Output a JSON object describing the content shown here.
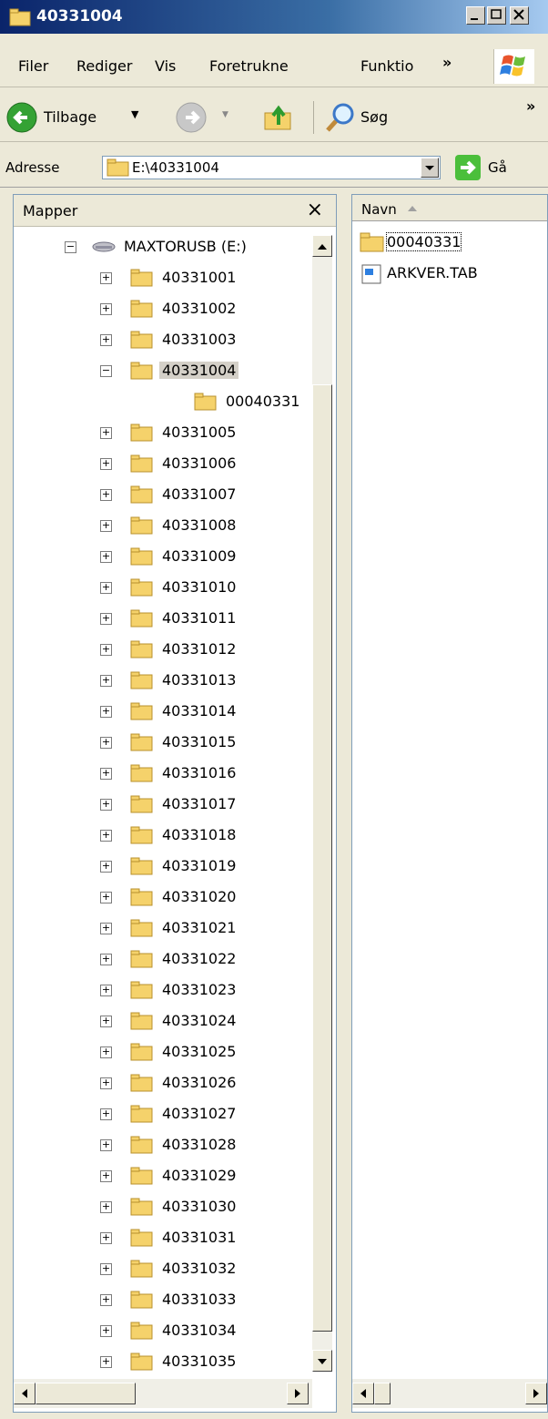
{
  "window": {
    "title": "40331004"
  },
  "menu": {
    "items": [
      "Filer",
      "Rediger",
      "Vis",
      "Foretrukne",
      "Funktio"
    ],
    "overflow": "»"
  },
  "toolbar": {
    "back_label": "Tilbage",
    "search_label": "Søg",
    "overflow": "»"
  },
  "address": {
    "label": "Adresse",
    "value": "E:\\40331004",
    "go_label": "Gå"
  },
  "folders_pane": {
    "title": "Mapper",
    "close": "×",
    "drive": "MAXTORUSB (E:)",
    "items": [
      {
        "label": "40331001",
        "expander": "+"
      },
      {
        "label": "40331002",
        "expander": "+"
      },
      {
        "label": "40331003",
        "expander": "+"
      },
      {
        "label": "40331004",
        "expander": "-",
        "selected": true
      },
      {
        "label": "00040331",
        "expander": "",
        "child": true
      },
      {
        "label": "40331005",
        "expander": "+"
      },
      {
        "label": "40331006",
        "expander": "+"
      },
      {
        "label": "40331007",
        "expander": "+"
      },
      {
        "label": "40331008",
        "expander": "+"
      },
      {
        "label": "40331009",
        "expander": "+"
      },
      {
        "label": "40331010",
        "expander": "+"
      },
      {
        "label": "40331011",
        "expander": "+"
      },
      {
        "label": "40331012",
        "expander": "+"
      },
      {
        "label": "40331013",
        "expander": "+"
      },
      {
        "label": "40331014",
        "expander": "+"
      },
      {
        "label": "40331015",
        "expander": "+"
      },
      {
        "label": "40331016",
        "expander": "+"
      },
      {
        "label": "40331017",
        "expander": "+"
      },
      {
        "label": "40331018",
        "expander": "+"
      },
      {
        "label": "40331019",
        "expander": "+"
      },
      {
        "label": "40331020",
        "expander": "+"
      },
      {
        "label": "40331021",
        "expander": "+"
      },
      {
        "label": "40331022",
        "expander": "+"
      },
      {
        "label": "40331023",
        "expander": "+"
      },
      {
        "label": "40331024",
        "expander": "+"
      },
      {
        "label": "40331025",
        "expander": "+"
      },
      {
        "label": "40331026",
        "expander": "+"
      },
      {
        "label": "40331027",
        "expander": "+"
      },
      {
        "label": "40331028",
        "expander": "+"
      },
      {
        "label": "40331029",
        "expander": "+"
      },
      {
        "label": "40331030",
        "expander": "+"
      },
      {
        "label": "40331031",
        "expander": "+"
      },
      {
        "label": "40331032",
        "expander": "+"
      },
      {
        "label": "40331033",
        "expander": "+"
      },
      {
        "label": "40331034",
        "expander": "+"
      },
      {
        "label": "40331035",
        "expander": "+"
      }
    ]
  },
  "file_list": {
    "column": "Navn",
    "items": [
      {
        "name": "00040331",
        "type": "folder"
      },
      {
        "name": "ARKVER.TAB",
        "type": "file"
      }
    ]
  }
}
